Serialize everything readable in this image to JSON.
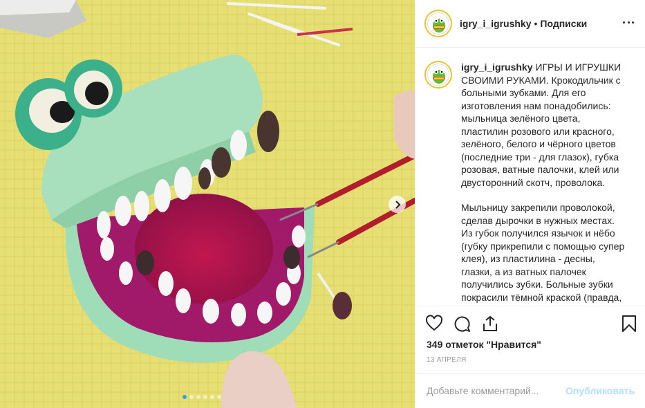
{
  "header": {
    "username": "igry_i_igrushky",
    "separator": "•",
    "follow_label": "Подписки"
  },
  "caption": {
    "username": "igry_i_igrushky",
    "paragraph1": "ИГРЫ И ИГРУШКИ СВОИМИ РУКАМИ. Крокодильчик с больными зубками. Для его изготовления нам понадобились: мыльница зелёного цвета, пластилин розового или красного, зелёного, белого и чёрного цветов (последние три - для глазок), губка розовая, ватные палочки, клей или двусторонний скотч, проволока.",
    "paragraph2": "Мыльницу закрепили проволокой, сделав дырочки в нужных местах. Из губок получился язычок и нёбо (губку прикрепили с помощью супер клея), из пластилина - десны, глазки, а из ватных палочек получились зубки. Больные зубки покрасили тёмной краской (правда,"
  },
  "stats": {
    "likes": "349 отметок \"Нравится\"",
    "date": "13 апреля"
  },
  "comment": {
    "placeholder": "Добавьте комментарий...",
    "post_label": "Опубликовать"
  },
  "carousel": {
    "count": 6,
    "active_index": 0
  },
  "icons": {
    "like": "heart-icon",
    "comment": "comment-icon",
    "share": "share-icon",
    "save": "bookmark-icon",
    "more": "more-options-icon",
    "next": "chevron-right-icon"
  },
  "colors": {
    "accent": "#3897f0",
    "post_button": "#b2dffc",
    "avatar_ring": "#e8c430"
  }
}
